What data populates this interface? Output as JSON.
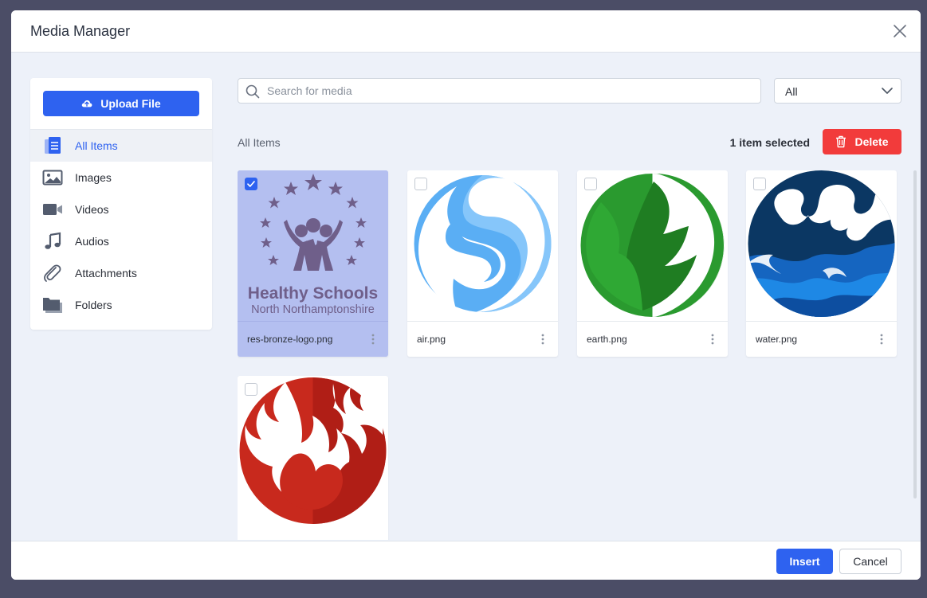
{
  "modal": {
    "title": "Media Manager",
    "close_icon": "close-icon"
  },
  "sidebar": {
    "upload_label": "Upload File",
    "upload_icon": "cloud-upload-icon",
    "items": [
      {
        "label": "All Items",
        "icon": "document-stack-icon",
        "active": true
      },
      {
        "label": "Images",
        "icon": "image-icon",
        "active": false
      },
      {
        "label": "Videos",
        "icon": "video-camera-icon",
        "active": false
      },
      {
        "label": "Audios",
        "icon": "music-note-icon",
        "active": false
      },
      {
        "label": "Attachments",
        "icon": "paperclip-icon",
        "active": false
      },
      {
        "label": "Folders",
        "icon": "folder-icon",
        "active": false
      }
    ]
  },
  "toolbar": {
    "search_placeholder": "Search for media",
    "search_value": "",
    "filter_value": "All",
    "section_label": "All Items",
    "selected_count": "1 item selected",
    "delete_label": "Delete",
    "delete_icon": "trash-icon"
  },
  "media": [
    {
      "name": "res-bronze-logo.png",
      "selected": true,
      "logo_line1": "Healthy Schools",
      "logo_line2": "North Northamptonshire"
    },
    {
      "name": "air.png",
      "selected": false
    },
    {
      "name": "earth.png",
      "selected": false
    },
    {
      "name": "water.png",
      "selected": false
    },
    {
      "name": "",
      "selected": false
    }
  ],
  "footer": {
    "insert_label": "Insert",
    "cancel_label": "Cancel"
  },
  "colors": {
    "primary": "#2e62f0",
    "danger": "#f23b3b",
    "selected_card": "#b4bff0",
    "backdrop": "#4b4d66"
  }
}
